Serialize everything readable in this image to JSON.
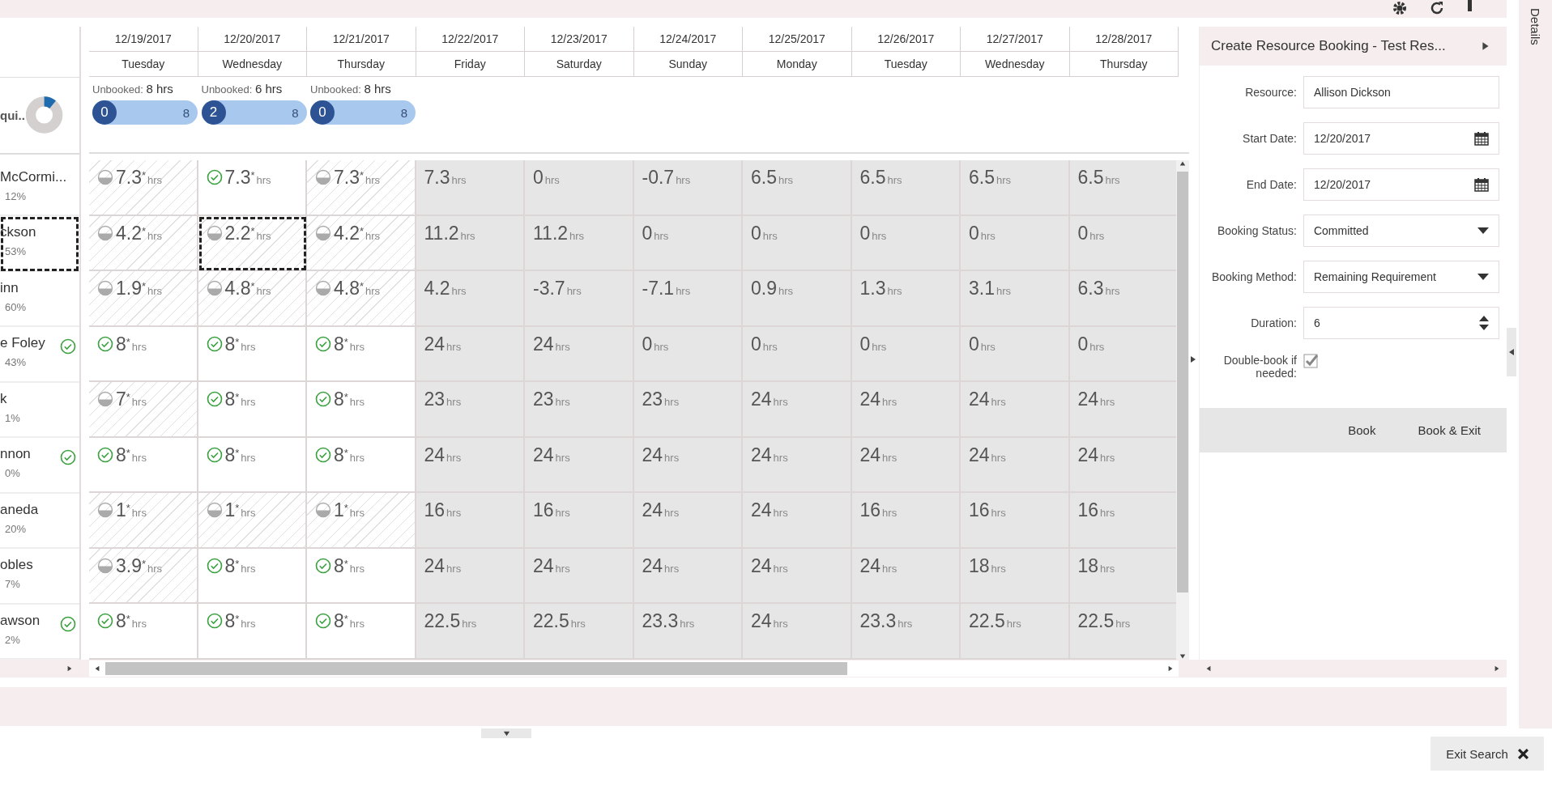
{
  "dates": [
    {
      "date": "12/19/2017",
      "day": "Tuesday"
    },
    {
      "date": "12/20/2017",
      "day": "Wednesday"
    },
    {
      "date": "12/21/2017",
      "day": "Thursday"
    },
    {
      "date": "12/22/2017",
      "day": "Friday"
    },
    {
      "date": "12/23/2017",
      "day": "Saturday"
    },
    {
      "date": "12/24/2017",
      "day": "Sunday"
    },
    {
      "date": "12/25/2017",
      "day": "Monday"
    },
    {
      "date": "12/26/2017",
      "day": "Tuesday"
    },
    {
      "date": "12/27/2017",
      "day": "Wednesday"
    },
    {
      "date": "12/28/2017",
      "day": "Thursday"
    }
  ],
  "requirement": {
    "label": "qui..",
    "unbooked": [
      {
        "label": "Unbooked:",
        "hours": "8 hrs",
        "booked": "0",
        "total": "8"
      },
      {
        "label": "Unbooked:",
        "hours": "6 hrs",
        "booked": "2",
        "total": "8"
      },
      {
        "label": "Unbooked:",
        "hours": "8 hrs",
        "booked": "0",
        "total": "8"
      }
    ]
  },
  "resources": [
    {
      "name": "McCormi...",
      "percent": "12%",
      "match": false,
      "selected": false,
      "cells": [
        {
          "value": "7.3",
          "suffix": "*",
          "unit": "hrs",
          "kind": "partial",
          "selected": false
        },
        {
          "value": "7.3",
          "suffix": "*",
          "unit": "hrs",
          "kind": "full",
          "selected": false
        },
        {
          "value": "7.3",
          "suffix": "*",
          "unit": "hrs",
          "kind": "partial",
          "selected": false
        },
        {
          "value": "7.3",
          "unit": "hrs",
          "kind": "open"
        },
        {
          "value": "0",
          "unit": "hrs",
          "kind": "open"
        },
        {
          "value": "-0.7",
          "unit": "hrs",
          "kind": "open"
        },
        {
          "value": "6.5",
          "unit": "hrs",
          "kind": "open"
        },
        {
          "value": "6.5",
          "unit": "hrs",
          "kind": "open"
        },
        {
          "value": "6.5",
          "unit": "hrs",
          "kind": "open"
        },
        {
          "value": "6.5",
          "unit": "hrs",
          "kind": "open"
        }
      ]
    },
    {
      "name": "ckson",
      "percent": "53%",
      "match": false,
      "selected": true,
      "cells": [
        {
          "value": "4.2",
          "suffix": "*",
          "unit": "hrs",
          "kind": "partial",
          "selected": false
        },
        {
          "value": "2.2",
          "suffix": "*",
          "unit": "hrs",
          "kind": "partial",
          "selected": true
        },
        {
          "value": "4.2",
          "suffix": "*",
          "unit": "hrs",
          "kind": "partial",
          "selected": false
        },
        {
          "value": "11.2",
          "unit": "hrs",
          "kind": "open"
        },
        {
          "value": "11.2",
          "unit": "hrs",
          "kind": "open"
        },
        {
          "value": "0",
          "unit": "hrs",
          "kind": "open"
        },
        {
          "value": "0",
          "unit": "hrs",
          "kind": "open"
        },
        {
          "value": "0",
          "unit": "hrs",
          "kind": "open"
        },
        {
          "value": "0",
          "unit": "hrs",
          "kind": "open"
        },
        {
          "value": "0",
          "unit": "hrs",
          "kind": "open"
        }
      ]
    },
    {
      "name": "inn",
      "percent": "60%",
      "match": false,
      "selected": false,
      "cells": [
        {
          "value": "1.9",
          "suffix": "*",
          "unit": "hrs",
          "kind": "partial",
          "selected": false
        },
        {
          "value": "4.8",
          "suffix": "*",
          "unit": "hrs",
          "kind": "partial",
          "selected": false
        },
        {
          "value": "4.8",
          "suffix": "*",
          "unit": "hrs",
          "kind": "partial",
          "selected": false
        },
        {
          "value": "4.2",
          "unit": "hrs",
          "kind": "open"
        },
        {
          "value": "-3.7",
          "unit": "hrs",
          "kind": "open"
        },
        {
          "value": "-7.1",
          "unit": "hrs",
          "kind": "open"
        },
        {
          "value": "0.9",
          "unit": "hrs",
          "kind": "open"
        },
        {
          "value": "1.3",
          "unit": "hrs",
          "kind": "open"
        },
        {
          "value": "3.1",
          "unit": "hrs",
          "kind": "open"
        },
        {
          "value": "6.3",
          "unit": "hrs",
          "kind": "open"
        }
      ]
    },
    {
      "name": "e Foley",
      "percent": "43%",
      "match": true,
      "selected": false,
      "cells": [
        {
          "value": "8",
          "suffix": "*",
          "unit": "hrs",
          "kind": "full",
          "selected": false
        },
        {
          "value": "8",
          "suffix": "*",
          "unit": "hrs",
          "kind": "full",
          "selected": false
        },
        {
          "value": "8",
          "suffix": "*",
          "unit": "hrs",
          "kind": "full",
          "selected": false
        },
        {
          "value": "24",
          "unit": "hrs",
          "kind": "open"
        },
        {
          "value": "24",
          "unit": "hrs",
          "kind": "open"
        },
        {
          "value": "0",
          "unit": "hrs",
          "kind": "open"
        },
        {
          "value": "0",
          "unit": "hrs",
          "kind": "open"
        },
        {
          "value": "0",
          "unit": "hrs",
          "kind": "open"
        },
        {
          "value": "0",
          "unit": "hrs",
          "kind": "open"
        },
        {
          "value": "0",
          "unit": "hrs",
          "kind": "open"
        }
      ]
    },
    {
      "name": "k",
      "percent": "1%",
      "match": false,
      "selected": false,
      "cells": [
        {
          "value": "7",
          "suffix": "*",
          "unit": "hrs",
          "kind": "partial",
          "selected": false
        },
        {
          "value": "8",
          "suffix": "*",
          "unit": "hrs",
          "kind": "full",
          "selected": false
        },
        {
          "value": "8",
          "suffix": "*",
          "unit": "hrs",
          "kind": "full",
          "selected": false
        },
        {
          "value": "23",
          "unit": "hrs",
          "kind": "open"
        },
        {
          "value": "23",
          "unit": "hrs",
          "kind": "open"
        },
        {
          "value": "23",
          "unit": "hrs",
          "kind": "open"
        },
        {
          "value": "24",
          "unit": "hrs",
          "kind": "open"
        },
        {
          "value": "24",
          "unit": "hrs",
          "kind": "open"
        },
        {
          "value": "24",
          "unit": "hrs",
          "kind": "open"
        },
        {
          "value": "24",
          "unit": "hrs",
          "kind": "open"
        }
      ]
    },
    {
      "name": "nnon",
      "percent": "0%",
      "match": true,
      "selected": false,
      "cells": [
        {
          "value": "8",
          "suffix": "*",
          "unit": "hrs",
          "kind": "full",
          "selected": false
        },
        {
          "value": "8",
          "suffix": "*",
          "unit": "hrs",
          "kind": "full",
          "selected": false
        },
        {
          "value": "8",
          "suffix": "*",
          "unit": "hrs",
          "kind": "full",
          "selected": false
        },
        {
          "value": "24",
          "unit": "hrs",
          "kind": "open"
        },
        {
          "value": "24",
          "unit": "hrs",
          "kind": "open"
        },
        {
          "value": "24",
          "unit": "hrs",
          "kind": "open"
        },
        {
          "value": "24",
          "unit": "hrs",
          "kind": "open"
        },
        {
          "value": "24",
          "unit": "hrs",
          "kind": "open"
        },
        {
          "value": "24",
          "unit": "hrs",
          "kind": "open"
        },
        {
          "value": "24",
          "unit": "hrs",
          "kind": "open"
        }
      ]
    },
    {
      "name": "aneda",
      "percent": "20%",
      "match": false,
      "selected": false,
      "cells": [
        {
          "value": "1",
          "suffix": "*",
          "unit": "hrs",
          "kind": "partial",
          "selected": false
        },
        {
          "value": "1",
          "suffix": "*",
          "unit": "hrs",
          "kind": "partial",
          "selected": false
        },
        {
          "value": "1",
          "suffix": "*",
          "unit": "hrs",
          "kind": "partial",
          "selected": false
        },
        {
          "value": "16",
          "unit": "hrs",
          "kind": "open"
        },
        {
          "value": "16",
          "unit": "hrs",
          "kind": "open"
        },
        {
          "value": "24",
          "unit": "hrs",
          "kind": "open"
        },
        {
          "value": "24",
          "unit": "hrs",
          "kind": "open"
        },
        {
          "value": "16",
          "unit": "hrs",
          "kind": "open"
        },
        {
          "value": "16",
          "unit": "hrs",
          "kind": "open"
        },
        {
          "value": "16",
          "unit": "hrs",
          "kind": "open"
        }
      ]
    },
    {
      "name": "obles",
      "percent": "7%",
      "match": false,
      "selected": false,
      "cells": [
        {
          "value": "3.9",
          "suffix": "*",
          "unit": "hrs",
          "kind": "partial",
          "selected": false
        },
        {
          "value": "8",
          "suffix": "*",
          "unit": "hrs",
          "kind": "full",
          "selected": false
        },
        {
          "value": "8",
          "suffix": "*",
          "unit": "hrs",
          "kind": "full",
          "selected": false
        },
        {
          "value": "24",
          "unit": "hrs",
          "kind": "open"
        },
        {
          "value": "24",
          "unit": "hrs",
          "kind": "open"
        },
        {
          "value": "24",
          "unit": "hrs",
          "kind": "open"
        },
        {
          "value": "24",
          "unit": "hrs",
          "kind": "open"
        },
        {
          "value": "24",
          "unit": "hrs",
          "kind": "open"
        },
        {
          "value": "18",
          "unit": "hrs",
          "kind": "open"
        },
        {
          "value": "18",
          "unit": "hrs",
          "kind": "open"
        }
      ]
    },
    {
      "name": "awson",
      "percent": "2%",
      "match": true,
      "selected": false,
      "cells": [
        {
          "value": "8",
          "suffix": "*",
          "unit": "hrs",
          "kind": "full",
          "selected": false
        },
        {
          "value": "8",
          "suffix": "*",
          "unit": "hrs",
          "kind": "full",
          "selected": false
        },
        {
          "value": "8",
          "suffix": "*",
          "unit": "hrs",
          "kind": "full",
          "selected": false
        },
        {
          "value": "22.5",
          "unit": "hrs",
          "kind": "open"
        },
        {
          "value": "22.5",
          "unit": "hrs",
          "kind": "open"
        },
        {
          "value": "23.3",
          "unit": "hrs",
          "kind": "open"
        },
        {
          "value": "24",
          "unit": "hrs",
          "kind": "open"
        },
        {
          "value": "23.3",
          "unit": "hrs",
          "kind": "open"
        },
        {
          "value": "22.5",
          "unit": "hrs",
          "kind": "open"
        },
        {
          "value": "22.5",
          "unit": "hrs",
          "kind": "open"
        }
      ]
    }
  ],
  "booking_panel": {
    "title": "Create Resource Booking - Test Res...",
    "fields": [
      {
        "kind": "text",
        "label": "Resource:",
        "value": "Allison Dickson"
      },
      {
        "kind": "date",
        "label": "Start Date:",
        "value": "12/20/2017"
      },
      {
        "kind": "date",
        "label": "End Date:",
        "value": "12/20/2017"
      },
      {
        "kind": "select",
        "label": "Booking Status:",
        "value": "Committed"
      },
      {
        "kind": "select",
        "label": "Booking Method:",
        "value": "Remaining Requirement"
      },
      {
        "kind": "number",
        "label": "Duration:",
        "value": "6"
      },
      {
        "kind": "checkbox",
        "label": "Double-book if needed:",
        "checked": true
      }
    ],
    "buttons": [
      "Book",
      "Book & Exit"
    ]
  },
  "details_tab": "Details",
  "exit_search": "Exit Search"
}
